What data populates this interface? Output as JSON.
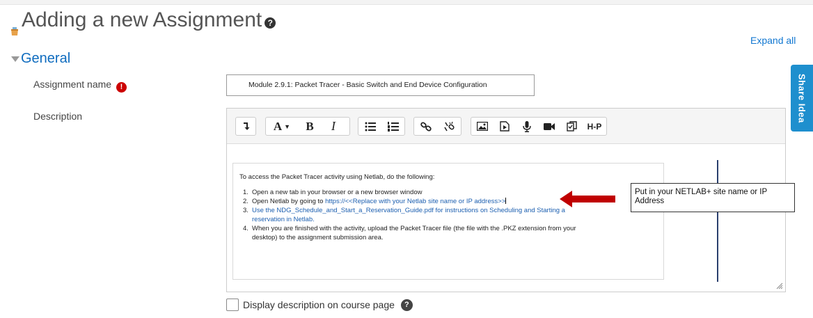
{
  "page": {
    "title": "Adding a new Assignment",
    "expand_all": "Expand all",
    "section": "General"
  },
  "form": {
    "assignment_name_label": "Assignment name",
    "assignment_name_value": "Module 2.9.1:  Packet Tracer - Basic Switch and End Device Configuration",
    "description_label": "Description",
    "display_description_label": "Display description on course page"
  },
  "toolbar": {
    "icons": [
      "collapse-icon",
      "font-color-icon",
      "bold-icon",
      "italic-icon",
      "unordered-list-icon",
      "ordered-list-icon",
      "link-icon",
      "unlink-icon",
      "image-icon",
      "media-icon",
      "record-audio-icon",
      "record-video-icon",
      "manage-files-icon",
      "h5p-icon"
    ],
    "bold": "B",
    "italic": "I",
    "font": "A",
    "h5p": "H-P"
  },
  "editor_content": {
    "intro": "To access the Packet Tracer activity using Netlab, do the following:",
    "step1": "Open a new tab in your browser or a new browser window",
    "step2_prefix": "Open Netlab by going to ",
    "step2_link": "https://<<Replace with your Netlab site name or IP address>>",
    "step3_line1": "Use the  NDG_Schedule_and_Start_a_Reservation_Guide.pdf for instructions on Scheduling and Starting a",
    "step3_line2": "reservation in Netlab.",
    "step4_line1": "When you are finished with the activity, upload the Packet Tracer file (the file with the .PKZ extension from your",
    "step4_line2": "desktop) to the assignment submission area."
  },
  "callout": {
    "text": "Put in your NETLAB+ site name or IP Address"
  },
  "share_tab": "Share Idea",
  "colors": {
    "link": "#0f6cbf",
    "share": "#1e8fce",
    "arrow": "#c00000",
    "required": "#cc0000"
  }
}
